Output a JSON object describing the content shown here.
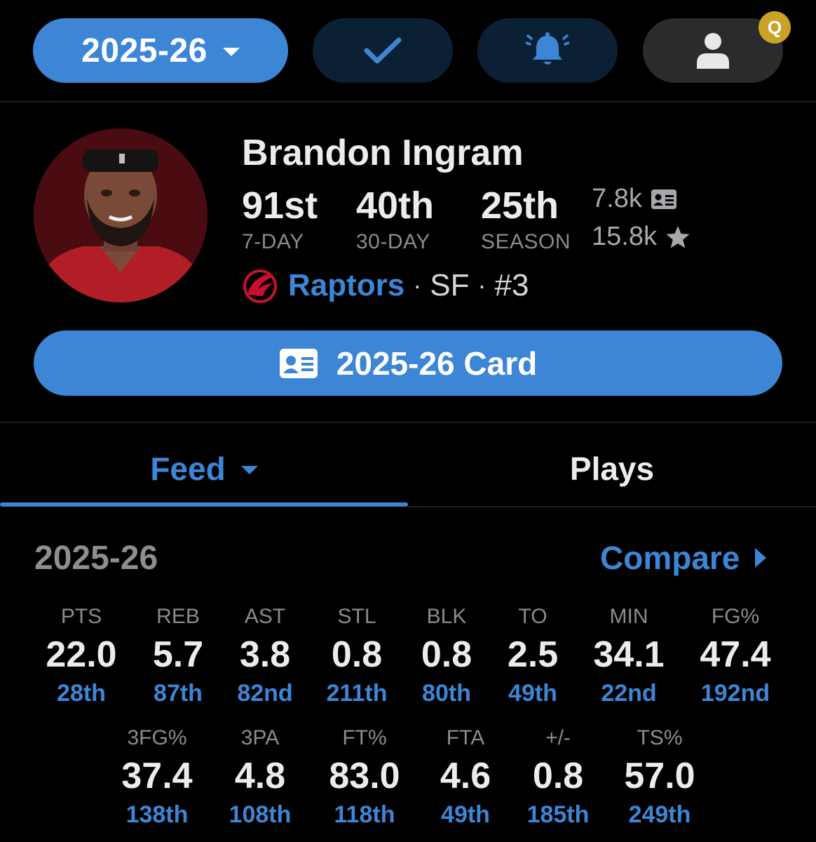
{
  "topbar": {
    "season_label": "2025-26",
    "badge": "Q"
  },
  "player": {
    "name": "Brandon Ingram",
    "ranks": [
      {
        "value": "91st",
        "label": "7-DAY"
      },
      {
        "value": "40th",
        "label": "30-DAY"
      },
      {
        "value": "25th",
        "label": "SEASON"
      }
    ],
    "card_count": "7.8k",
    "favorites_count": "15.8k",
    "team": "Raptors",
    "separator": "·",
    "position": "SF",
    "number": "#3",
    "card_button_label": "2025-26 Card"
  },
  "tabs": {
    "feed": "Feed",
    "plays": "Plays"
  },
  "stats_section": {
    "season": "2025-26",
    "compare_label": "Compare",
    "row1": [
      {
        "key": "PTS",
        "value": "22.0",
        "rank": "28th"
      },
      {
        "key": "REB",
        "value": "5.7",
        "rank": "87th"
      },
      {
        "key": "AST",
        "value": "3.8",
        "rank": "82nd"
      },
      {
        "key": "STL",
        "value": "0.8",
        "rank": "211th"
      },
      {
        "key": "BLK",
        "value": "0.8",
        "rank": "80th"
      },
      {
        "key": "TO",
        "value": "2.5",
        "rank": "49th"
      },
      {
        "key": "MIN",
        "value": "34.1",
        "rank": "22nd"
      },
      {
        "key": "FG%",
        "value": "47.4",
        "rank": "192nd"
      }
    ],
    "row2": [
      {
        "key": "3FG%",
        "value": "37.4",
        "rank": "138th"
      },
      {
        "key": "3PA",
        "value": "4.8",
        "rank": "108th"
      },
      {
        "key": "FT%",
        "value": "83.0",
        "rank": "118th"
      },
      {
        "key": "FTA",
        "value": "4.6",
        "rank": "49th"
      },
      {
        "key": "+/-",
        "value": "0.8",
        "rank": "185th"
      },
      {
        "key": "TS%",
        "value": "57.0",
        "rank": "249th"
      }
    ]
  },
  "colors": {
    "accent": "#3d86d6",
    "background": "#000000",
    "badge": "#c9a227"
  }
}
